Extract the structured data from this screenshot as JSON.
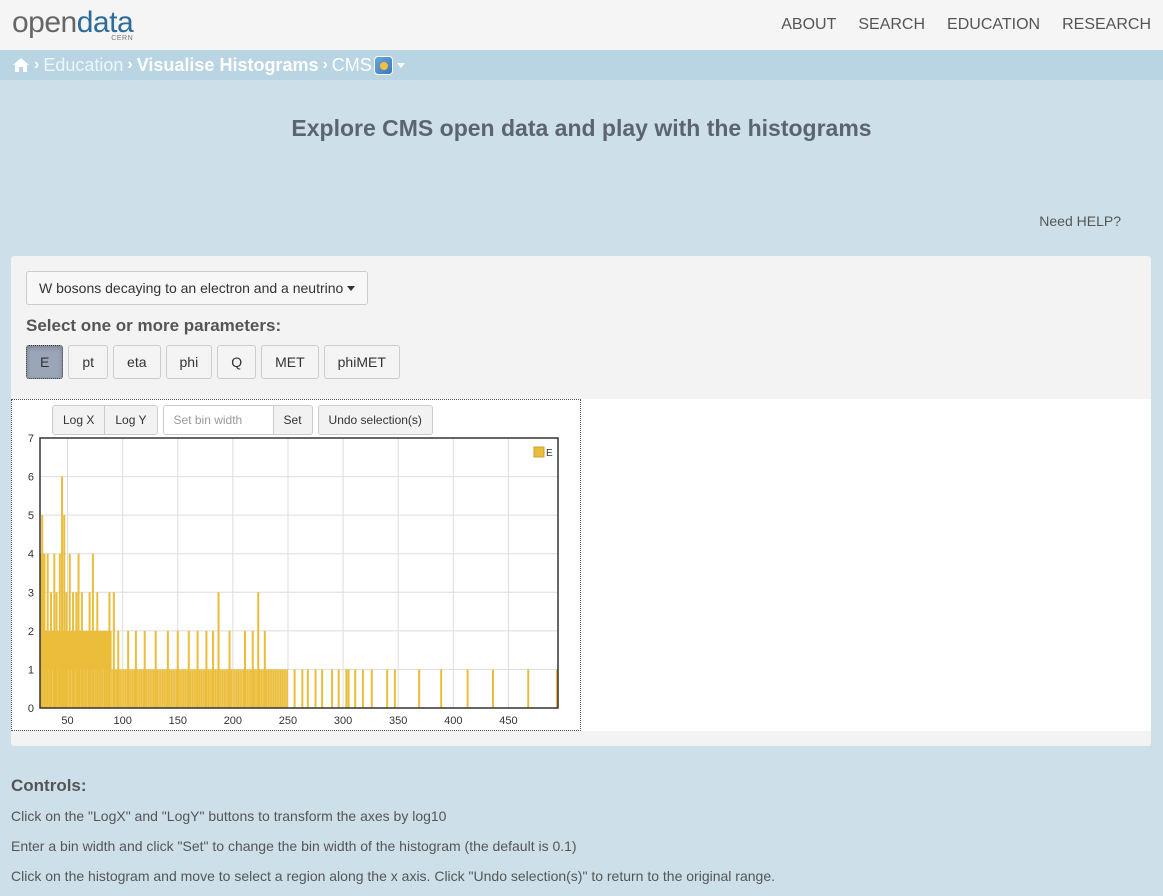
{
  "header": {
    "logo_open": "open",
    "logo_data": "data",
    "logo_cern": "CERN",
    "nav": [
      "ABOUT",
      "SEARCH",
      "EDUCATION",
      "RESEARCH"
    ]
  },
  "breadcrumb": {
    "home_icon": "home-icon",
    "items": [
      "Education",
      "Visualise Histograms",
      "CMS"
    ]
  },
  "page": {
    "title": "Explore CMS open data and play with the histograms",
    "help_link": "Need HELP?"
  },
  "panel": {
    "dataset_label": "W bosons decaying to an electron and a neutrino",
    "params_heading": "Select one or more parameters:",
    "params": [
      "E",
      "pt",
      "eta",
      "phi",
      "Q",
      "MET",
      "phiMET"
    ],
    "active_param": "E",
    "toolbar": {
      "logx": "Log X",
      "logy": "Log Y",
      "bin_placeholder": "Set bin width",
      "set": "Set",
      "undo": "Undo selection(s)"
    }
  },
  "chart_data": {
    "type": "bar",
    "series": [
      {
        "name": "E",
        "color": "#ebbd3a"
      }
    ],
    "xlim": [
      25,
      495
    ],
    "ylim": [
      0,
      7
    ],
    "xticks": [
      50,
      100,
      150,
      200,
      250,
      300,
      350,
      400,
      450
    ],
    "yticks": [
      0,
      1,
      2,
      3,
      4,
      5,
      6,
      7
    ],
    "grid": true,
    "legend_position": "top-right",
    "bin_width": 0.1,
    "segments": [
      {
        "from": 25,
        "to": 30,
        "level": 4
      },
      {
        "from": 30,
        "to": 60,
        "level": 2
      },
      {
        "from": 60,
        "to": 90,
        "level": 2
      },
      {
        "from": 90,
        "to": 200,
        "level": 1
      },
      {
        "from": 200,
        "to": 250,
        "level": 1
      }
    ],
    "spikes": [
      {
        "x": 27,
        "y": 5
      },
      {
        "x": 29,
        "y": 3
      },
      {
        "x": 32,
        "y": 4
      },
      {
        "x": 35,
        "y": 3
      },
      {
        "x": 38,
        "y": 4
      },
      {
        "x": 40,
        "y": 3
      },
      {
        "x": 43,
        "y": 4
      },
      {
        "x": 45,
        "y": 6
      },
      {
        "x": 47,
        "y": 5
      },
      {
        "x": 49,
        "y": 3
      },
      {
        "x": 52,
        "y": 4
      },
      {
        "x": 55,
        "y": 3
      },
      {
        "x": 58,
        "y": 3
      },
      {
        "x": 60,
        "y": 4
      },
      {
        "x": 63,
        "y": 3
      },
      {
        "x": 66,
        "y": 2
      },
      {
        "x": 70,
        "y": 3
      },
      {
        "x": 73,
        "y": 4
      },
      {
        "x": 77,
        "y": 3
      },
      {
        "x": 80,
        "y": 2
      },
      {
        "x": 85,
        "y": 2
      },
      {
        "x": 88,
        "y": 3
      },
      {
        "x": 92,
        "y": 3
      },
      {
        "x": 96,
        "y": 2
      },
      {
        "x": 105,
        "y": 2
      },
      {
        "x": 112,
        "y": 2
      },
      {
        "x": 120,
        "y": 2
      },
      {
        "x": 130,
        "y": 2
      },
      {
        "x": 141,
        "y": 2
      },
      {
        "x": 150,
        "y": 2
      },
      {
        "x": 160,
        "y": 2
      },
      {
        "x": 168,
        "y": 2
      },
      {
        "x": 176,
        "y": 2
      },
      {
        "x": 182,
        "y": 2
      },
      {
        "x": 187,
        "y": 3
      },
      {
        "x": 197,
        "y": 2
      },
      {
        "x": 211,
        "y": 2
      },
      {
        "x": 218,
        "y": 2
      },
      {
        "x": 223,
        "y": 3
      },
      {
        "x": 229,
        "y": 2
      },
      {
        "x": 256,
        "y": 1
      },
      {
        "x": 263,
        "y": 1
      },
      {
        "x": 268,
        "y": 1
      },
      {
        "x": 275,
        "y": 1
      },
      {
        "x": 281,
        "y": 1
      },
      {
        "x": 290,
        "y": 1
      },
      {
        "x": 296,
        "y": 1
      },
      {
        "x": 303,
        "y": 1
      },
      {
        "x": 305,
        "y": 1
      },
      {
        "x": 311,
        "y": 1
      },
      {
        "x": 318,
        "y": 1
      },
      {
        "x": 326,
        "y": 1
      },
      {
        "x": 340,
        "y": 1
      },
      {
        "x": 347,
        "y": 1
      },
      {
        "x": 369,
        "y": 1
      },
      {
        "x": 389,
        "y": 1
      },
      {
        "x": 413,
        "y": 1
      },
      {
        "x": 436,
        "y": 1
      },
      {
        "x": 468,
        "y": 1
      },
      {
        "x": 494,
        "y": 1
      }
    ]
  },
  "controls": {
    "heading": "Controls:",
    "lines": [
      "Click on the \"LogX\" and \"LogY\" buttons to transform the axes by log10",
      "Enter a bin width and click \"Set\" to change the bin width of the histogram (the default is 0.1)",
      "Click on the histogram and move to select a region along the x axis. Click \"Undo selection(s)\" to return to the original range."
    ]
  }
}
